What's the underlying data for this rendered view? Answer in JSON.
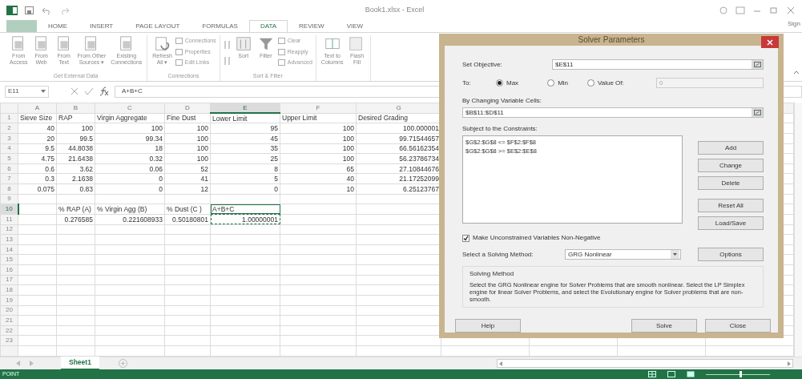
{
  "title_bar": {
    "title": "Book1.xlsx - Excel",
    "account": "Sign"
  },
  "ribbon": {
    "tabs": [
      {
        "label": "HOME",
        "selected": false
      },
      {
        "label": "INSERT",
        "selected": false
      },
      {
        "label": "PAGE LAYOUT",
        "selected": false
      },
      {
        "label": "FORMULAS",
        "selected": false
      },
      {
        "label": "DATA",
        "selected": true
      },
      {
        "label": "REVIEW",
        "selected": false
      },
      {
        "label": "VIEW",
        "selected": false
      }
    ],
    "groups": [
      {
        "label": "Get External Data",
        "items": [
          {
            "kind": "large",
            "label": "From\nAccess"
          },
          {
            "kind": "large",
            "label": "From\nWeb"
          },
          {
            "kind": "large",
            "label": "From\nText"
          },
          {
            "kind": "large",
            "label": "From Other\nSources ▾"
          },
          {
            "kind": "large",
            "label": "Existing\nConnections"
          }
        ]
      },
      {
        "label": "Connections",
        "items": [
          {
            "kind": "large",
            "label": "Refresh\nAll ▾"
          },
          {
            "kind": "stack",
            "entries": [
              "Connections",
              "Properties",
              "Edit Links"
            ]
          }
        ]
      },
      {
        "label": "Sort & Filter",
        "items": [
          {
            "kind": "sorters"
          },
          {
            "kind": "large",
            "label": "Sort"
          },
          {
            "kind": "large",
            "label": "Filter"
          },
          {
            "kind": "stack",
            "entries": [
              "Clear",
              "Reapply",
              "Advanced"
            ]
          }
        ]
      },
      {
        "items": [
          {
            "kind": "large",
            "label": "Text to\nColumns"
          },
          {
            "kind": "large",
            "label": "Flash\nFill"
          }
        ]
      }
    ]
  },
  "formula_bar": {
    "name_box": "E11",
    "formula": "A+B+C"
  },
  "sheet": {
    "columns": [
      {
        "label": "A",
        "selected": false
      },
      {
        "label": "B",
        "selected": false
      },
      {
        "label": "C",
        "selected": false
      },
      {
        "label": "D",
        "selected": false
      },
      {
        "label": "E",
        "selected": true
      },
      {
        "label": "F",
        "selected": false
      },
      {
        "label": "G",
        "selected": false
      }
    ],
    "rows": [
      {
        "number": "1",
        "selected": false,
        "kind": "labels",
        "cells": [
          {
            "text": "Sieve Size"
          },
          {
            "text": "RAP"
          },
          {
            "text": "Virgin Aggregate"
          },
          {
            "text": "Fine Dust"
          },
          {
            "text": "Lower Limit"
          },
          {
            "text": "Upper Limit"
          },
          {
            "text": "Desired Grading"
          }
        ]
      },
      {
        "number": "2",
        "selected": false,
        "kind": "values",
        "cells": [
          {
            "text": "40"
          },
          {
            "text": "100"
          },
          {
            "text": "100"
          },
          {
            "text": "100"
          },
          {
            "text": "95"
          },
          {
            "text": "100"
          },
          {
            "text": "100.000001"
          }
        ]
      },
      {
        "number": "3",
        "selected": false,
        "kind": "values",
        "cells": [
          {
            "text": "20"
          },
          {
            "text": "99.5"
          },
          {
            "text": "99.34"
          },
          {
            "text": "100"
          },
          {
            "text": "45"
          },
          {
            "text": "100"
          },
          {
            "text": "99.71544657"
          }
        ]
      },
      {
        "number": "4",
        "selected": false,
        "kind": "values",
        "cells": [
          {
            "text": "9.5"
          },
          {
            "text": "44.8038"
          },
          {
            "text": "18"
          },
          {
            "text": "100"
          },
          {
            "text": "35"
          },
          {
            "text": "100"
          },
          {
            "text": "66.56162354"
          }
        ]
      },
      {
        "number": "5",
        "selected": false,
        "kind": "values",
        "cells": [
          {
            "text": "4.75"
          },
          {
            "text": "21.6438"
          },
          {
            "text": "0.32"
          },
          {
            "text": "100"
          },
          {
            "text": "25"
          },
          {
            "text": "100"
          },
          {
            "text": "56.23786734"
          }
        ]
      },
      {
        "number": "6",
        "selected": false,
        "kind": "values",
        "cells": [
          {
            "text": "0.6"
          },
          {
            "text": "3.62"
          },
          {
            "text": "0.06"
          },
          {
            "text": "52"
          },
          {
            "text": "8"
          },
          {
            "text": "65"
          },
          {
            "text": "27.10844676"
          }
        ]
      },
      {
        "number": "7",
        "selected": false,
        "kind": "values",
        "cells": [
          {
            "text": "0.3"
          },
          {
            "text": "2.1638"
          },
          {
            "text": "0"
          },
          {
            "text": "41"
          },
          {
            "text": "5"
          },
          {
            "text": "40"
          },
          {
            "text": "21.17252099"
          }
        ]
      },
      {
        "number": "8",
        "selected": false,
        "kind": "values",
        "cells": [
          {
            "text": "0.075"
          },
          {
            "text": "0.83"
          },
          {
            "text": "0"
          },
          {
            "text": "12"
          },
          {
            "text": "0"
          },
          {
            "text": "10"
          },
          {
            "text": "6.25123767"
          }
        ]
      },
      {
        "number": "9",
        "selected": false
      },
      {
        "number": "10",
        "selected": true,
        "kind": "labels",
        "cells": [
          null,
          {
            "text": "% RAP (A)"
          },
          {
            "text": "% Virgin Agg (B)"
          },
          {
            "text": "% Dust (C )"
          },
          {
            "text": "A+B+C",
            "active": true
          },
          null,
          null
        ]
      },
      {
        "number": "11",
        "selected": false,
        "kind": "values",
        "cells": [
          null,
          {
            "text": "0.276585"
          },
          {
            "text": "0.221608933"
          },
          {
            "text": "0.50180801"
          },
          {
            "text": "1.00000001",
            "copied": true
          },
          null,
          null
        ]
      },
      {
        "number": "12",
        "selected": false
      },
      {
        "number": "13",
        "selected": false
      },
      {
        "number": "14",
        "selected": false
      },
      {
        "number": "15",
        "selected": false
      },
      {
        "number": "16",
        "selected": false
      },
      {
        "number": "17",
        "selected": false
      },
      {
        "number": "18",
        "selected": false
      },
      {
        "number": "19",
        "selected": false
      },
      {
        "number": "20",
        "selected": false
      },
      {
        "number": "21",
        "selected": false
      },
      {
        "number": "22",
        "selected": false
      },
      {
        "number": "23",
        "selected": false
      }
    ]
  },
  "sheet_tabs": [
    {
      "label": "Sheet1",
      "selected": true
    }
  ],
  "status_bar": {
    "mode": "POINT",
    "zoom": {
      "level": 0.55
    }
  },
  "solver": {
    "title": "Solver Parameters",
    "objective_label": "Set Objective:",
    "objective": "$E$11",
    "to_label": "To:",
    "targets": [
      {
        "label": "Max",
        "selected": true
      },
      {
        "label": "Min",
        "selected": false
      },
      {
        "label": "Value Of:",
        "selected": false
      }
    ],
    "value_of": {
      "value": "0",
      "disabled": true
    },
    "changing_label": "By Changing Variable Cells:",
    "changing": "$B$11:$D$11",
    "constraints_label": "Subject to the Constraints:",
    "constraints": [
      "$G$2:$G$8 <= $F$2:$F$8",
      "$G$2:$G$8 >= $E$2:$E$8"
    ],
    "side_buttons": [
      "Add",
      "Change",
      "Delete",
      "Reset All",
      "Load/Save"
    ],
    "nonnegative": {
      "label": "Make Unconstrained Variables Non-Negative",
      "checked": true
    },
    "method_label": "Select a Solving Method:",
    "method": "GRG Nonlinear",
    "options_button": "Options",
    "group_title": "Solving Method",
    "description": "Select the GRG Nonlinear engine for Solver Problems that are smooth nonlinear. Select the LP Simplex engine for linear Solver Problems, and select the Evolutionary engine for Solver problems that are non-smooth.",
    "footer_buttons": [
      "Help",
      "Solve",
      "Close"
    ]
  }
}
